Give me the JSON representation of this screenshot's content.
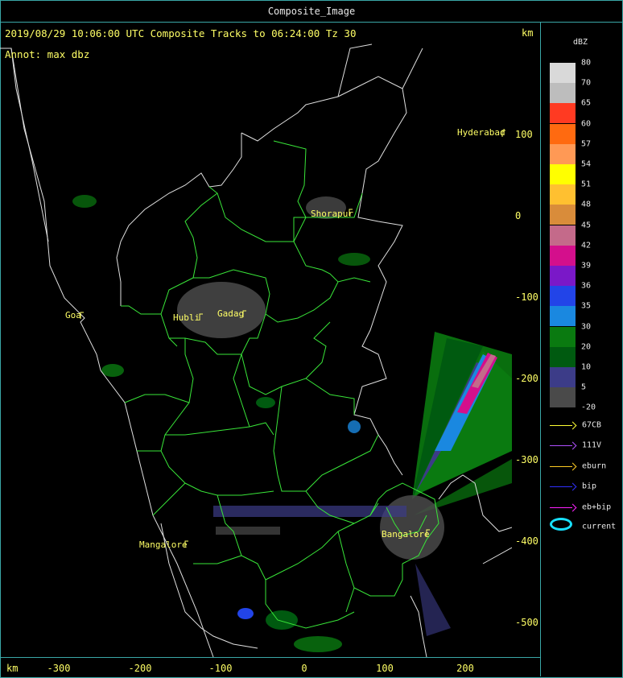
{
  "window": {
    "title": "Composite_Image"
  },
  "header": {
    "text": "2019/08/29 10:06:00 UTC Composite Tracks to 06:24:00 Tz 30",
    "annot": "Annot: max dbz"
  },
  "axes": {
    "units_top": "km",
    "units_bottom": "km",
    "x_ticks": [
      "-300",
      "-200",
      "-100",
      "0",
      "100",
      "200"
    ],
    "y_ticks": [
      "100",
      "0",
      "-100",
      "-200",
      "-300",
      "-400",
      "-500"
    ]
  },
  "legend": {
    "title": "dBZ",
    "scale": [
      {
        "label": "80",
        "color": "#d9d9d9"
      },
      {
        "label": "70",
        "color": "#bdbdbd"
      },
      {
        "label": "65",
        "color": "#ff3a22"
      },
      {
        "label": "60",
        "color": "#ff6a10"
      },
      {
        "label": "57",
        "color": "#ff9955"
      },
      {
        "label": "54",
        "color": "#ffff00"
      },
      {
        "label": "51",
        "color": "#ffc030"
      },
      {
        "label": "48",
        "color": "#d98c3a"
      },
      {
        "label": "45",
        "color": "#c46a8a"
      },
      {
        "label": "42",
        "color": "#d40f8c"
      },
      {
        "label": "39",
        "color": "#7a18c8"
      },
      {
        "label": "36",
        "color": "#2244e8"
      },
      {
        "label": "35",
        "color": "#1a88e0"
      },
      {
        "label": "30",
        "color": "#0a7a10"
      },
      {
        "label": "20",
        "color": "#005a10"
      },
      {
        "label": "10",
        "color": "#3c3c88"
      },
      {
        "label": "5",
        "color": "#4a4a4a"
      },
      {
        "label": "-20",
        "color": "#000000"
      }
    ],
    "tracks": [
      {
        "label": "67CB",
        "color": "#ffff33"
      },
      {
        "label": "111V",
        "color": "#b050ff"
      },
      {
        "label": "eburn",
        "color": "#ffcc22"
      },
      {
        "label": "bip",
        "color": "#3030ff"
      },
      {
        "label": "eb+bip",
        "color": "#ff22ff"
      }
    ],
    "current_label": "current"
  },
  "cities": [
    {
      "name": "Hyderabad"
    },
    {
      "name": "Shorapur"
    },
    {
      "name": "Goa"
    },
    {
      "name": "Hubli"
    },
    {
      "name": "Gadag"
    },
    {
      "name": "Mangalore"
    },
    {
      "name": "Bangalore"
    }
  ],
  "colors": {
    "border": "#3aa7a7",
    "text": "#ffff66",
    "districts": "#39e639",
    "states": "#e0e0e0"
  }
}
